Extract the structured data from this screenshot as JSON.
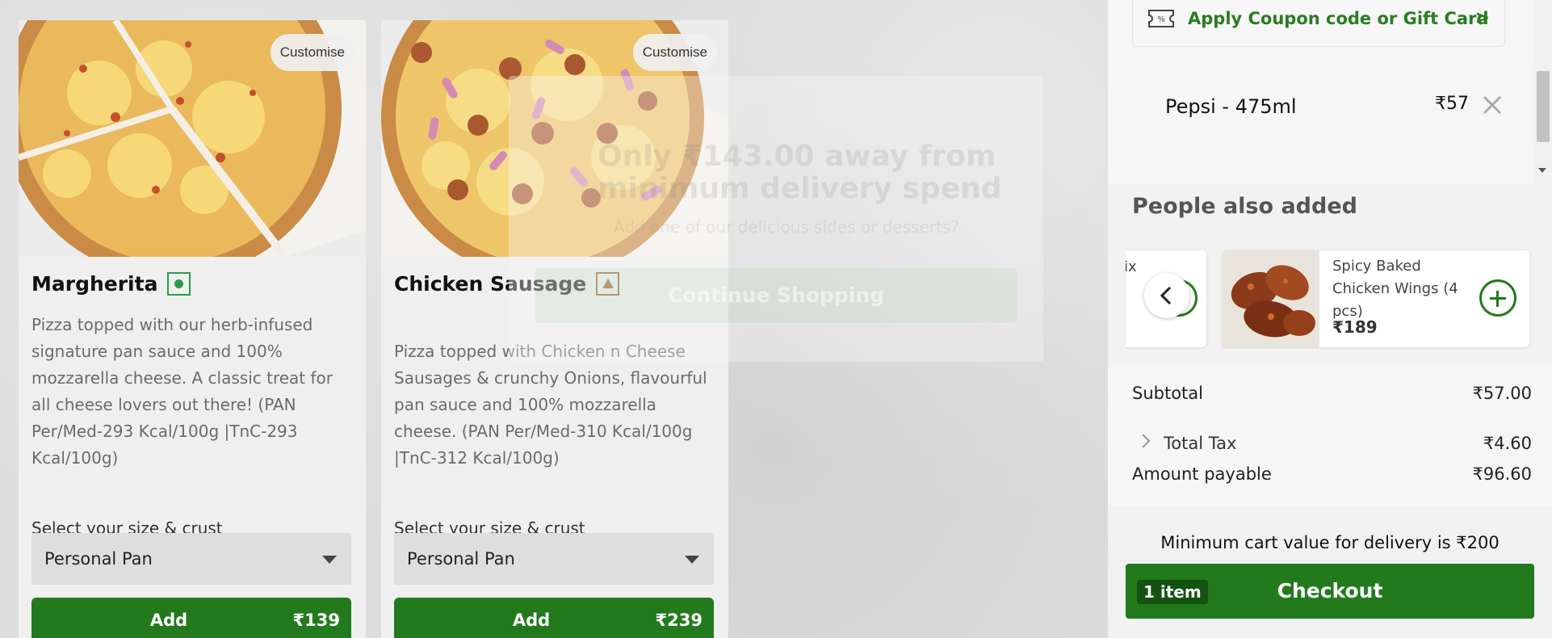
{
  "products": [
    {
      "customise_label": "Customise",
      "name": "Margherita",
      "diet": "veg",
      "description": "Pizza topped with our herb-infused signature pan sauce and 100% mozzarella cheese. A classic treat for all cheese lovers out there! (PAN Per/Med-293 Kcal/100g |TnC-293 Kcal/100g)",
      "size_label": "Select your size & crust",
      "selected_size": "Personal Pan",
      "add_label": "Add",
      "price": "₹139"
    },
    {
      "customise_label": "Customise",
      "name": "Chicken Sausage",
      "diet": "non-veg",
      "description": "Pizza topped with Chicken n Cheese Sausages & crunchy Onions, flavourful pan sauce and 100% mozzarella cheese. (PAN Per/Med-310 Kcal/100g |TnC-312 Kcal/100g)",
      "size_label": "Select your size & crust",
      "selected_size": "Personal Pan",
      "add_label": "Add",
      "price": "₹239"
    }
  ],
  "modal": {
    "heading": "Only ₹143.00 away from minimum delivery spend",
    "subtext": "Add one of our delicious sides or desserts?",
    "button_label": "Continue Shopping"
  },
  "cart": {
    "coupon_label": "Apply Coupon code or Gift Card",
    "coupon_arrow": ">",
    "items": [
      {
        "name": "Pepsi - 475ml",
        "price": "₹57"
      }
    ],
    "people_also_added_title": "People also added",
    "recommendations": [
      {
        "name": "ix",
        "partial": true
      },
      {
        "name": "Spicy Baked Chicken Wings (4 pcs)",
        "price": "₹189"
      }
    ],
    "subtotal_label": "Subtotal",
    "subtotal_value": "₹57.00",
    "tax_label": "Total Tax",
    "tax_value": "₹4.60",
    "payable_label": "Amount payable",
    "payable_value": "₹96.60",
    "min_cart_text": "Minimum cart value for delivery is ₹200",
    "item_count": "1 item",
    "checkout_label": "Checkout"
  },
  "colors": {
    "brand_green": "#227a1d",
    "veg_green": "#2e9b4a",
    "nonveg_brown": "#a0522d"
  },
  "icons": {
    "coupon": "coupon-ticket-icon",
    "remove": "close-icon",
    "carousel_prev": "chevron-left-icon",
    "add": "plus-circle-icon",
    "expand_tax": "chevron-right-icon",
    "dropdown": "caret-down-icon"
  }
}
